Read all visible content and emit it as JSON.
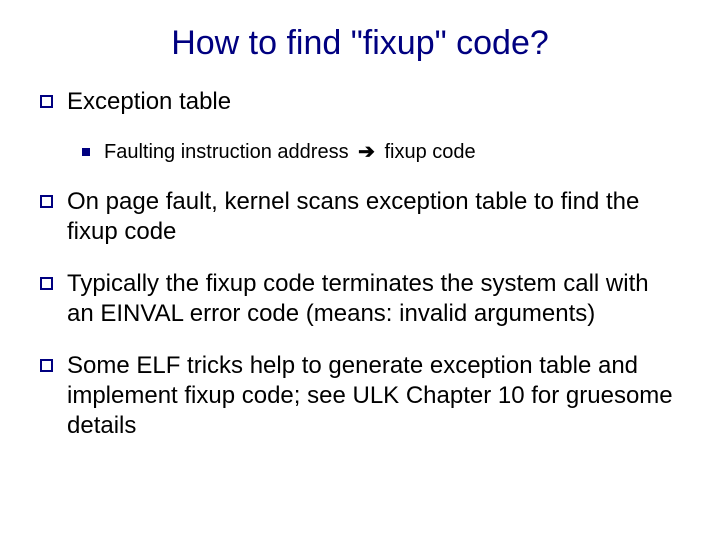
{
  "title": "How to find \"fixup\" code?",
  "bullets": {
    "b0": "Exception table",
    "sub0_prefix": "Faulting instruction address ",
    "sub0_arrow": "➔",
    "sub0_suffix": " fixup code",
    "b1": "On page fault, kernel scans exception table to find the fixup code",
    "b2": "Typically the fixup code terminates the system call with an EINVAL error code (means: invalid arguments)",
    "b3": "Some ELF tricks help to generate exception table and implement fixup code; see ULK Chapter 10 for gruesome details"
  }
}
